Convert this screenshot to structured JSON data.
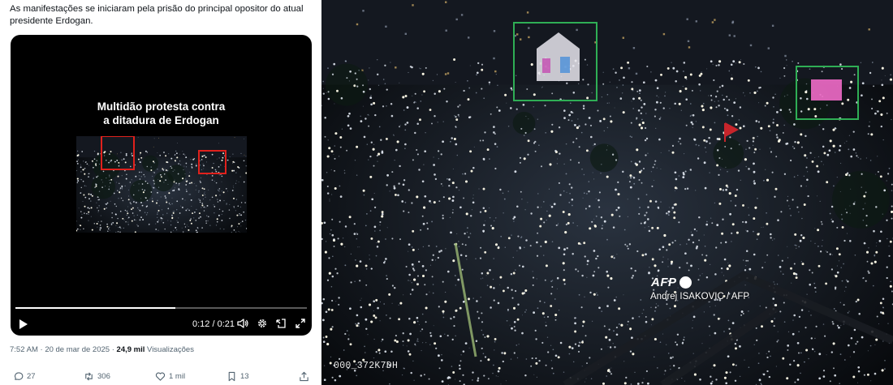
{
  "tweet": {
    "text": "As manifestações se iniciaram pela prisão do principal  opositor do atual presidente Erdogan.",
    "video": {
      "overlay_title": "Multidão protesta contra\na ditadura de Erdogan",
      "time": "0:12 / 0:21",
      "progress": 0.55
    },
    "meta": {
      "time": "7:52 AM",
      "date": "20 de mar de 2025",
      "views_count": "24,9 mil",
      "views_label": "Visualizações"
    },
    "actions": {
      "replies": "27",
      "reposts": "306",
      "likes": "1 mil",
      "bookmarks": "13"
    }
  },
  "photo": {
    "afp_logo": "AFP",
    "credit": "Andrej ISAKOVIC / AFP",
    "photo_id": "000_372K7DH"
  },
  "colors": {
    "highlight_red": "#e0211c",
    "highlight_green": "#2fae55",
    "text_primary": "#0f1419",
    "text_secondary": "#536471"
  }
}
